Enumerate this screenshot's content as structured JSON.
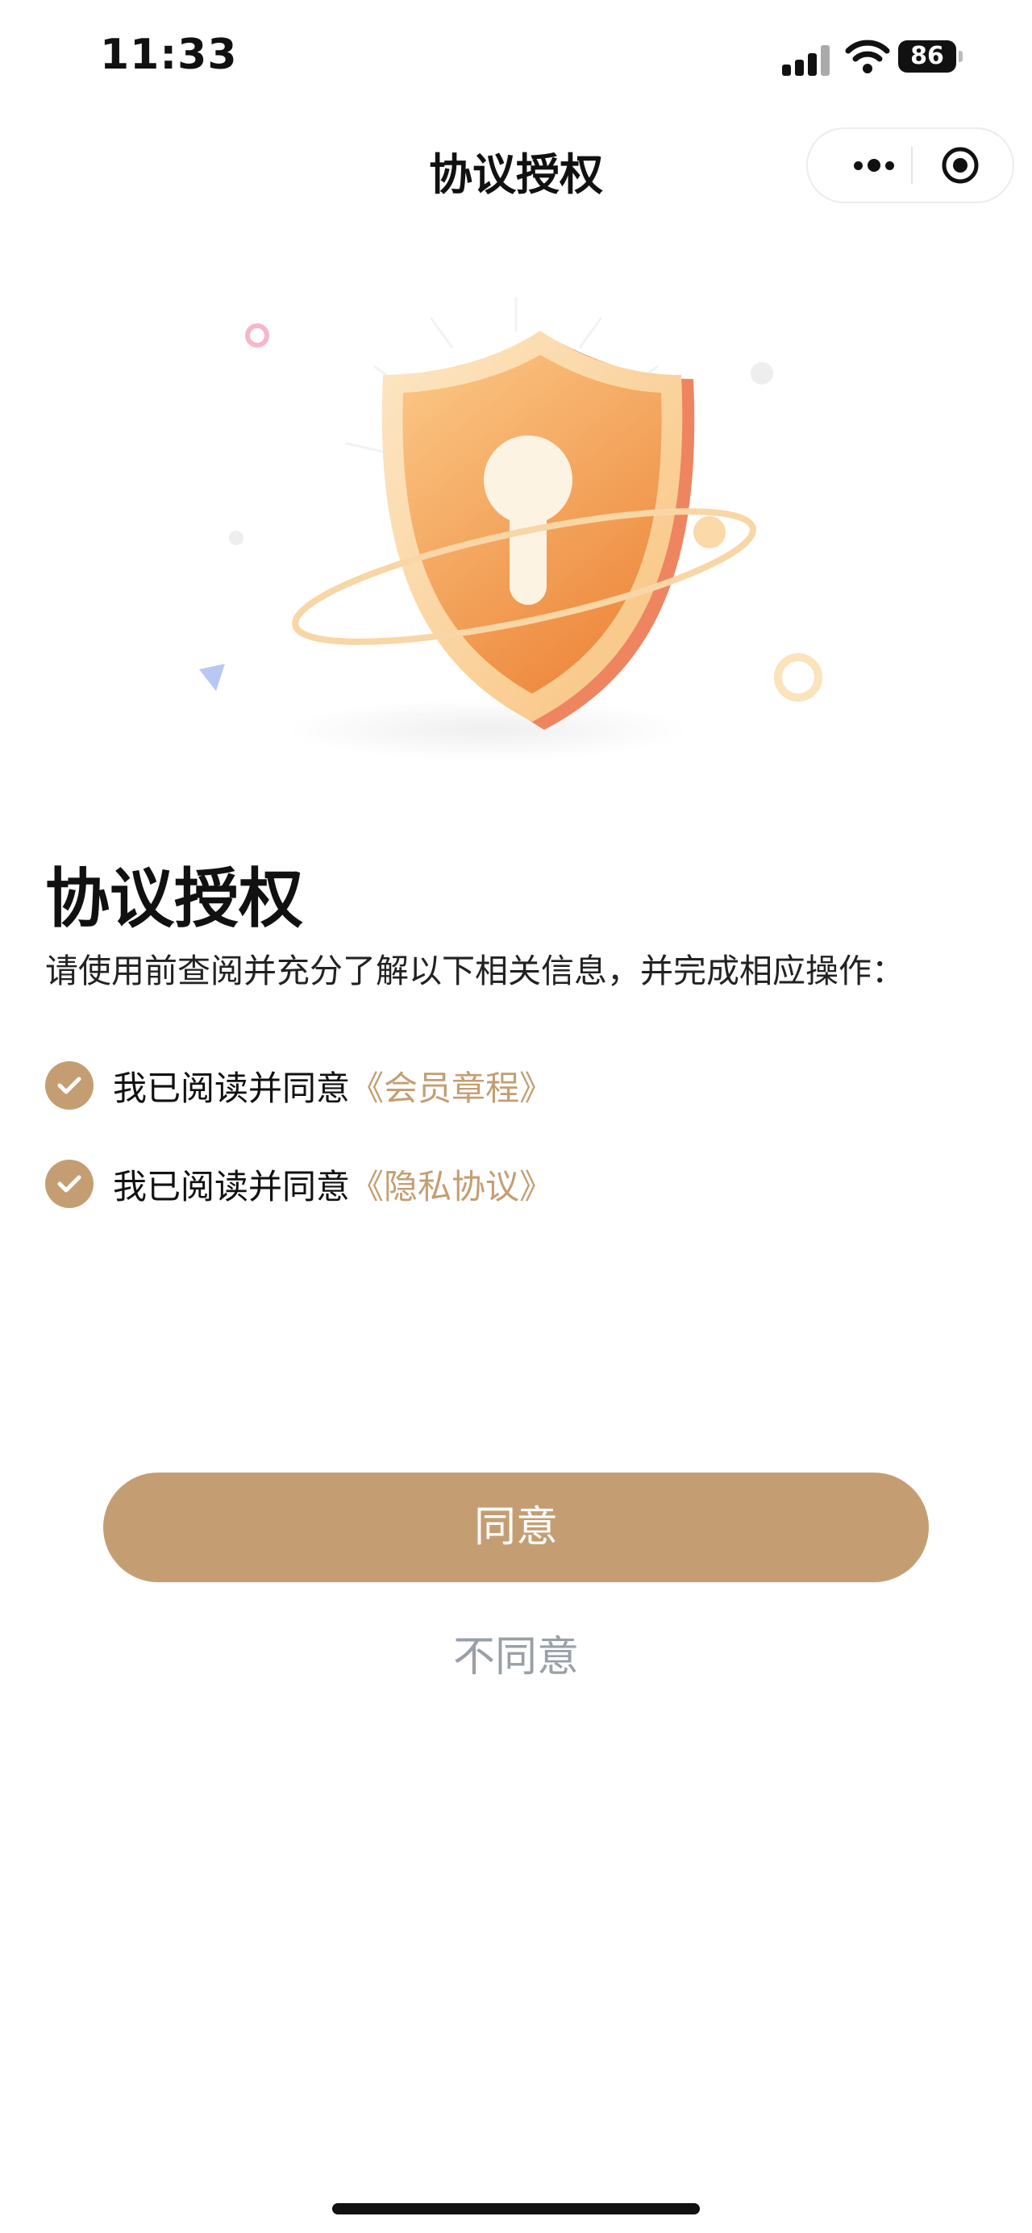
{
  "status_bar": {
    "time": "11:33",
    "battery": "86"
  },
  "nav": {
    "title": "协议授权"
  },
  "content": {
    "title": "协议授权",
    "subtitle": "请使用前查阅并充分了解以下相关信息，并完成相应操作：",
    "agreements": [
      {
        "prefix": "我已阅读并同意",
        "link": "《会员章程》",
        "checked": true
      },
      {
        "prefix": "我已阅读并同意",
        "link": "《隐私协议》",
        "checked": true
      }
    ]
  },
  "actions": {
    "agree_label": "同意",
    "disagree_label": "不同意"
  },
  "colors": {
    "accent": "#c49e72",
    "muted": "#9aa0a8"
  },
  "icons": {
    "hero": "shield-lock-illustration",
    "more": "more-dots-icon",
    "close": "target-close-icon",
    "check": "check-icon"
  }
}
